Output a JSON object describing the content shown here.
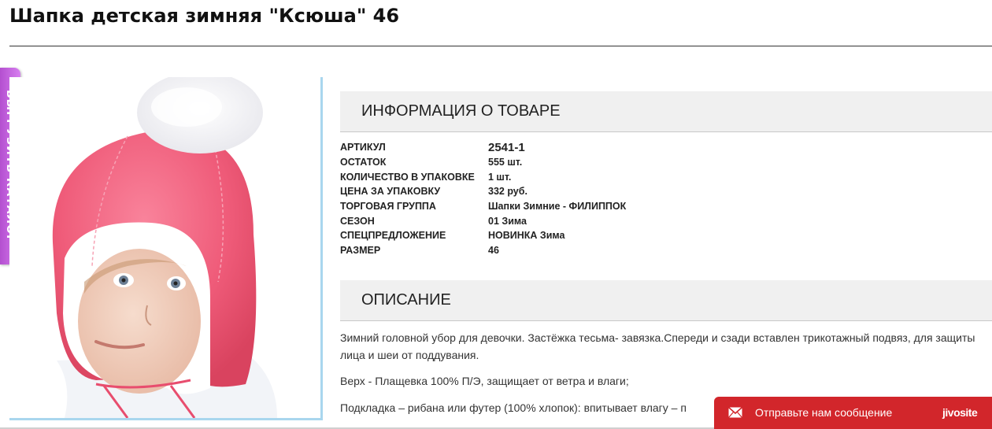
{
  "page": {
    "title": "Шапка детская зимняя \"Ксюша\" 46"
  },
  "catalog_tab": {
    "label": "ВЫГРУЗИТЬ КАТАЛОГ"
  },
  "product_image": {
    "icon": "product-photo",
    "colors": {
      "hat": "#f0607e",
      "lining": "#ffffff",
      "frame": "#a9d6ee"
    }
  },
  "info_section": {
    "title": "ИНФОРМАЦИЯ О ТОВАРЕ",
    "rows": [
      {
        "label": "АРТИКУЛ",
        "value": "2541-1"
      },
      {
        "label": "ОСТАТОК",
        "value": "555 шт."
      },
      {
        "label": "КОЛИЧЕСТВО В УПАКОВКЕ",
        "value": "1 шт."
      },
      {
        "label": "ЦЕНА ЗА УПАКОВКУ",
        "value": "332 руб."
      },
      {
        "label": "ТОРГОВАЯ ГРУППА",
        "value": "Шапки Зимние - ФИЛИППОК"
      },
      {
        "label": "СЕЗОН",
        "value": "01 Зима"
      },
      {
        "label": "СПЕЦПРЕДЛОЖЕНИЕ",
        "value": "НОВИНКА Зима"
      },
      {
        "label": "РАЗМЕР",
        "value": "46"
      }
    ]
  },
  "description_section": {
    "title": "ОПИСАНИЕ",
    "paragraphs": [
      "Зимний головной убор для девочки. Застёжка тесьма- завязка.Спереди и сзади вставлен трикотажный подвяз, для защиты лица и шеи от поддувания.",
      "Верх - Плащевка 100% П/Э, защищает от ветра и влаги;",
      "Подкладка – рибана или футер (100% хлопок): впитывает влагу – п"
    ]
  },
  "chat_widget": {
    "text": "Отправьте нам сообщение",
    "brand": "jivosite",
    "icon": "mail-icon",
    "color": "#d2262b"
  }
}
